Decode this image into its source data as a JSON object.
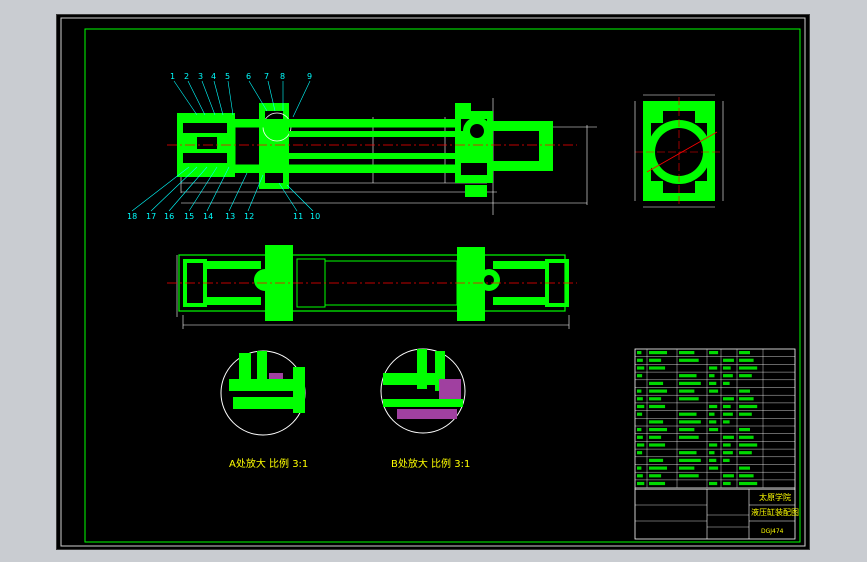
{
  "drawing": {
    "callouts_top": [
      "1",
      "2",
      "3",
      "4",
      "5",
      "6",
      "7",
      "8",
      "9"
    ],
    "callouts_bottom": [
      "18",
      "17",
      "16",
      "15",
      "14",
      "13",
      "12",
      "11",
      "10"
    ],
    "detail_a_caption": "A处放大  比例 3:1",
    "detail_b_caption": "B处放大  比例 3:1",
    "title_block": {
      "school": "太原学院",
      "drawing_name": "液压缸装配图",
      "drawing_no": "DGJ474"
    }
  },
  "colors": {
    "background": "#000000",
    "part_fill": "#00ff00",
    "frame": "#00ff00",
    "dimension": "#ffffff",
    "callout": "#00ffff",
    "centerline": "#ff0000",
    "hatch": "#a040a0",
    "text": "#ffff00"
  }
}
